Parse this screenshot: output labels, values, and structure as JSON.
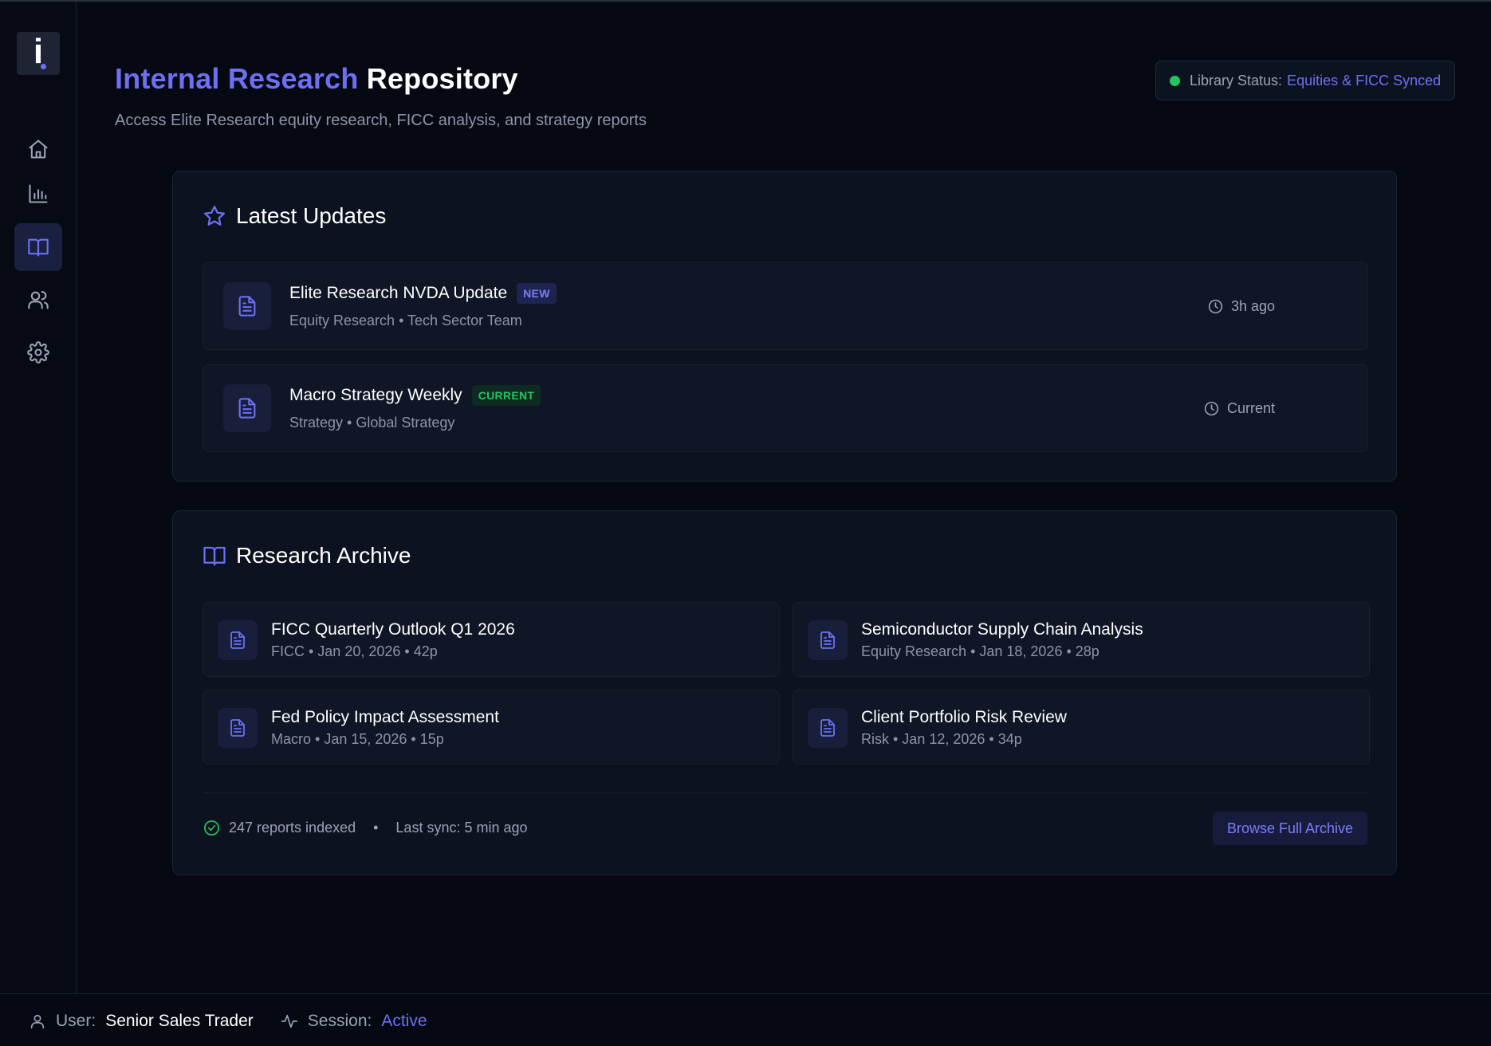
{
  "app": {
    "logo_letter": "i",
    "title_accent": "Internal Research",
    "title_rest": "Repository",
    "subtitle": "Access Elite Research equity research, FICC analysis, and strategy reports"
  },
  "sidebar": {
    "items": [
      {
        "icon": "home-icon",
        "active": false
      },
      {
        "icon": "bar-chart-icon",
        "active": false
      },
      {
        "icon": "book-open-icon",
        "active": true
      },
      {
        "icon": "users-icon",
        "active": false
      },
      {
        "icon": "gear-icon",
        "active": false
      }
    ]
  },
  "library_status": {
    "label": "Library Status:",
    "value": "Equities & FICC Synced",
    "dot_color": "#22c55e"
  },
  "latest_updates": {
    "title": "Latest Updates",
    "items": [
      {
        "title": "Elite Research NVDA Update",
        "badge": "NEW",
        "meta": "Equity Research • Tech Sector Team",
        "time": "3h ago"
      },
      {
        "title": "Macro Strategy Weekly",
        "badge": "CURRENT",
        "meta": "Strategy • Global Strategy",
        "time": "Current"
      }
    ]
  },
  "archive": {
    "title": "Research Archive",
    "items": [
      {
        "title": "FICC Quarterly Outlook Q1 2026",
        "meta": "FICC • Jan 20, 2026 • 42p"
      },
      {
        "title": "Semiconductor Supply Chain Analysis",
        "meta": "Equity Research • Jan 18, 2026 • 28p"
      },
      {
        "title": "Fed Policy Impact Assessment",
        "meta": "Macro • Jan 15, 2026 • 15p"
      },
      {
        "title": "Client Portfolio Risk Review",
        "meta": "Risk • Jan 12, 2026 • 34p"
      }
    ],
    "footer": {
      "indexed": "247 reports indexed",
      "separator": "•",
      "last_sync": "Last sync: 5 min ago",
      "browse_label": "Browse Full Archive"
    }
  },
  "statusbar": {
    "user_label": "User:",
    "user_value": "Senior Sales Trader",
    "session_label": "Session:",
    "session_value": "Active"
  },
  "colors": {
    "accent": "#6d6ff5",
    "success": "#22c55e",
    "background": "#060912",
    "panel": "#0c1220"
  }
}
